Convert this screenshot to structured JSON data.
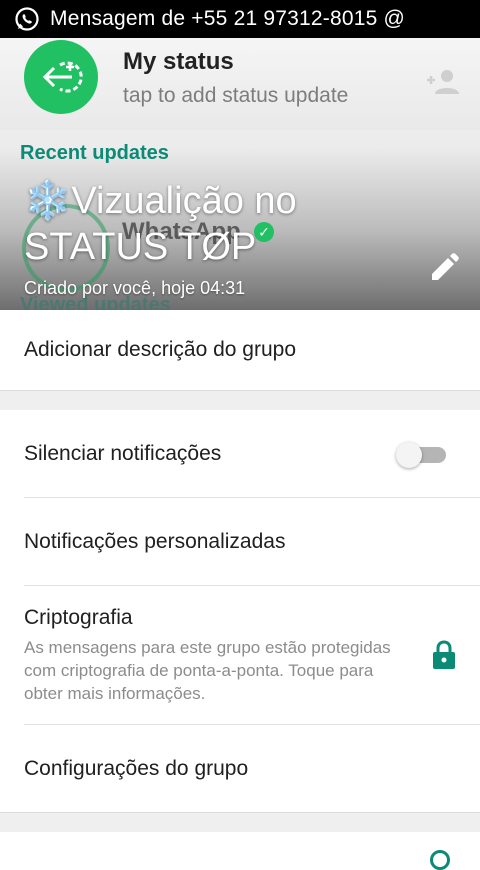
{
  "status_bar": {
    "notification_text": "Mensagem de +55 21 97312-8015 @",
    "app_icon": "whatsapp-icon"
  },
  "background_status": {
    "my_status_title": "My status",
    "my_status_subtitle": "tap to add status update",
    "recent_updates_label": "Recent updates",
    "contact_name": "WhatsApp",
    "viewed_updates_label": "Viewed updates",
    "add_contact_icon": "add-person-icon"
  },
  "group_header": {
    "name": "❄️Vizualição no STATUS TØP",
    "created": "Criado por você, hoje 04:31",
    "edit_icon": "pencil-icon"
  },
  "description": {
    "label": "Adicionar descrição do grupo"
  },
  "settings": {
    "mute_label": "Silenciar notificações",
    "mute_enabled": false,
    "custom_notifications_label": "Notificações personalizadas",
    "encryption_label": "Criptografia",
    "encryption_description": "As mensagens para este grupo estão protegidas com criptografia de ponta-a-ponta. Toque para obter mais informações.",
    "group_settings_label": "Configurações do grupo"
  },
  "colors": {
    "accent": "#0b8a76",
    "whatsapp_green": "#21c063",
    "status_bar": "#000000",
    "secondary_text": "#8c8c8c"
  }
}
